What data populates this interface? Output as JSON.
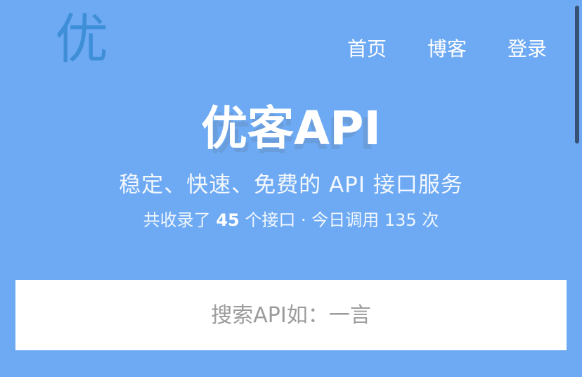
{
  "header": {
    "logo_text": "优",
    "nav": [
      {
        "label": "首页"
      },
      {
        "label": "博客"
      },
      {
        "label": "登录"
      }
    ]
  },
  "hero": {
    "title": "优客API",
    "title_shadow": "优客API",
    "tagline": "稳定、快速、免费的 API 接口服务",
    "stats": {
      "prefix": "共收录了 ",
      "api_count": "45",
      "middle": " 个接口 · 今日调用 ",
      "calls_today": "135",
      "suffix": " 次"
    }
  },
  "search": {
    "placeholder": "搜索API如：一言",
    "value": ""
  },
  "colors": {
    "background": "#6eaaf3",
    "logo": "#3f8fd8",
    "text": "#ffffff",
    "search_bg": "#ffffff",
    "placeholder": "#9c9c9c"
  }
}
